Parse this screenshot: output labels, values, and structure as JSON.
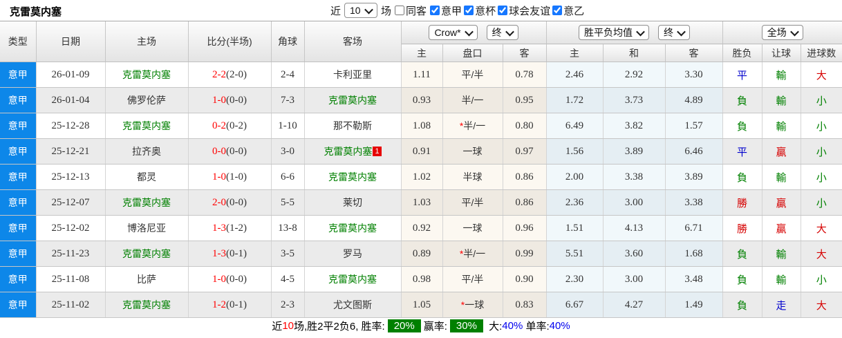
{
  "title": "克雷莫内塞",
  "controls": {
    "recent_label": "近",
    "recent_value": "10",
    "matches_label": "场",
    "same_venue": {
      "label": "同客",
      "checked": false
    },
    "leagues": [
      {
        "label": "意甲",
        "checked": true
      },
      {
        "label": "意杯",
        "checked": true
      },
      {
        "label": "球会友谊",
        "checked": true
      },
      {
        "label": "意乙",
        "checked": true
      }
    ]
  },
  "table": {
    "left_headers": [
      "类型",
      "日期",
      "主场",
      "比分(半场)",
      "角球",
      "客场"
    ],
    "odds_source_select": "Crow*",
    "odds_state_select": "终",
    "avg_select": "胜平负均值",
    "avg_state_select": "终",
    "scope_select": "全场",
    "sub_headers": [
      "主",
      "盘口",
      "客",
      "主",
      "和",
      "客",
      "胜负",
      "让球",
      "进球数"
    ],
    "rows": [
      {
        "league": "意甲",
        "date": "26-01-09",
        "home": "克雷莫内塞",
        "home_self": true,
        "score": "2-2",
        "half": "(2-0)",
        "corners": "2-4",
        "away": "卡利亚里",
        "away_self": false,
        "away_red_card": "",
        "odds_home": "1.11",
        "handicap": "平/半",
        "handicap_star": false,
        "odds_away": "0.78",
        "avg_home": "2.46",
        "avg_draw": "2.92",
        "avg_away": "3.30",
        "result": "平",
        "handicap_result": "輸",
        "goals_result": "大"
      },
      {
        "league": "意甲",
        "date": "26-01-04",
        "home": "佛罗伦萨",
        "home_self": false,
        "score": "1-0",
        "half": "(0-0)",
        "corners": "7-3",
        "away": "克雷莫内塞",
        "away_self": true,
        "away_red_card": "",
        "odds_home": "0.93",
        "handicap": "半/一",
        "handicap_star": false,
        "odds_away": "0.95",
        "avg_home": "1.72",
        "avg_draw": "3.73",
        "avg_away": "4.89",
        "result": "負",
        "handicap_result": "輸",
        "goals_result": "小"
      },
      {
        "league": "意甲",
        "date": "25-12-28",
        "home": "克雷莫内塞",
        "home_self": true,
        "score": "0-2",
        "half": "(0-2)",
        "corners": "1-10",
        "away": "那不勒斯",
        "away_self": false,
        "away_red_card": "",
        "odds_home": "1.08",
        "handicap": "半/一",
        "handicap_star": true,
        "odds_away": "0.80",
        "avg_home": "6.49",
        "avg_draw": "3.82",
        "avg_away": "1.57",
        "result": "負",
        "handicap_result": "輸",
        "goals_result": "小"
      },
      {
        "league": "意甲",
        "date": "25-12-21",
        "home": "拉齐奥",
        "home_self": false,
        "score": "0-0",
        "half": "(0-0)",
        "corners": "3-0",
        "away": "克雷莫内塞",
        "away_self": true,
        "away_red_card": "1",
        "odds_home": "0.91",
        "handicap": "一球",
        "handicap_star": false,
        "odds_away": "0.97",
        "avg_home": "1.56",
        "avg_draw": "3.89",
        "avg_away": "6.46",
        "result": "平",
        "handicap_result": "贏",
        "goals_result": "小"
      },
      {
        "league": "意甲",
        "date": "25-12-13",
        "home": "都灵",
        "home_self": false,
        "score": "1-0",
        "half": "(1-0)",
        "corners": "6-6",
        "away": "克雷莫内塞",
        "away_self": true,
        "away_red_card": "",
        "odds_home": "1.02",
        "handicap": "半球",
        "handicap_star": false,
        "odds_away": "0.86",
        "avg_home": "2.00",
        "avg_draw": "3.38",
        "avg_away": "3.89",
        "result": "負",
        "handicap_result": "輸",
        "goals_result": "小"
      },
      {
        "league": "意甲",
        "date": "25-12-07",
        "home": "克雷莫内塞",
        "home_self": true,
        "score": "2-0",
        "half": "(0-0)",
        "corners": "5-5",
        "away": "莱切",
        "away_self": false,
        "away_red_card": "",
        "odds_home": "1.03",
        "handicap": "平/半",
        "handicap_star": false,
        "odds_away": "0.86",
        "avg_home": "2.36",
        "avg_draw": "3.00",
        "avg_away": "3.38",
        "result": "勝",
        "handicap_result": "贏",
        "goals_result": "小"
      },
      {
        "league": "意甲",
        "date": "25-12-02",
        "home": "博洛尼亚",
        "home_self": false,
        "score": "1-3",
        "half": "(1-2)",
        "corners": "13-8",
        "away": "克雷莫内塞",
        "away_self": true,
        "away_red_card": "",
        "odds_home": "0.92",
        "handicap": "一球",
        "handicap_star": false,
        "odds_away": "0.96",
        "avg_home": "1.51",
        "avg_draw": "4.13",
        "avg_away": "6.71",
        "result": "勝",
        "handicap_result": "贏",
        "goals_result": "大"
      },
      {
        "league": "意甲",
        "date": "25-11-23",
        "home": "克雷莫内塞",
        "home_self": true,
        "score": "1-3",
        "half": "(0-1)",
        "corners": "3-5",
        "away": "罗马",
        "away_self": false,
        "away_red_card": "",
        "odds_home": "0.89",
        "handicap": "半/一",
        "handicap_star": true,
        "odds_away": "0.99",
        "avg_home": "5.51",
        "avg_draw": "3.60",
        "avg_away": "1.68",
        "result": "負",
        "handicap_result": "輸",
        "goals_result": "大"
      },
      {
        "league": "意甲",
        "date": "25-11-08",
        "home": "比萨",
        "home_self": false,
        "score": "1-0",
        "half": "(0-0)",
        "corners": "4-5",
        "away": "克雷莫内塞",
        "away_self": true,
        "away_red_card": "",
        "odds_home": "0.98",
        "handicap": "平/半",
        "handicap_star": false,
        "odds_away": "0.90",
        "avg_home": "2.30",
        "avg_draw": "3.00",
        "avg_away": "3.48",
        "result": "負",
        "handicap_result": "輸",
        "goals_result": "小"
      },
      {
        "league": "意甲",
        "date": "25-11-02",
        "home": "克雷莫内塞",
        "home_self": true,
        "score": "1-2",
        "half": "(0-1)",
        "corners": "2-3",
        "away": "尤文图斯",
        "away_self": false,
        "away_red_card": "",
        "odds_home": "1.05",
        "handicap": "一球",
        "handicap_star": true,
        "odds_away": "0.83",
        "avg_home": "6.67",
        "avg_draw": "4.27",
        "avg_away": "1.49",
        "result": "負",
        "handicap_result": "走",
        "goals_result": "大"
      }
    ]
  },
  "footer": {
    "prefix": "近",
    "count": "10",
    "mid": "场,胜2平2负6, 胜率:",
    "win_rate": "20%",
    "win_odds_label": "赢率:",
    "win_odds_rate": "30%",
    "over_label": "大:",
    "over_rate": "40%",
    "single_label": "单率:",
    "single_rate": "40%"
  },
  "colors": {
    "league_badge_blue": "#0d87e9",
    "self_team_green": "#008000",
    "score_red": "#ff0000",
    "result_win_red": "#d60000",
    "result_loss_green": "#008000",
    "result_draw_blue": "#0000cc",
    "rate_badge_green": "#008000",
    "percent_blue": "#0000ee",
    "checkbox_blue": "#1677ff"
  }
}
